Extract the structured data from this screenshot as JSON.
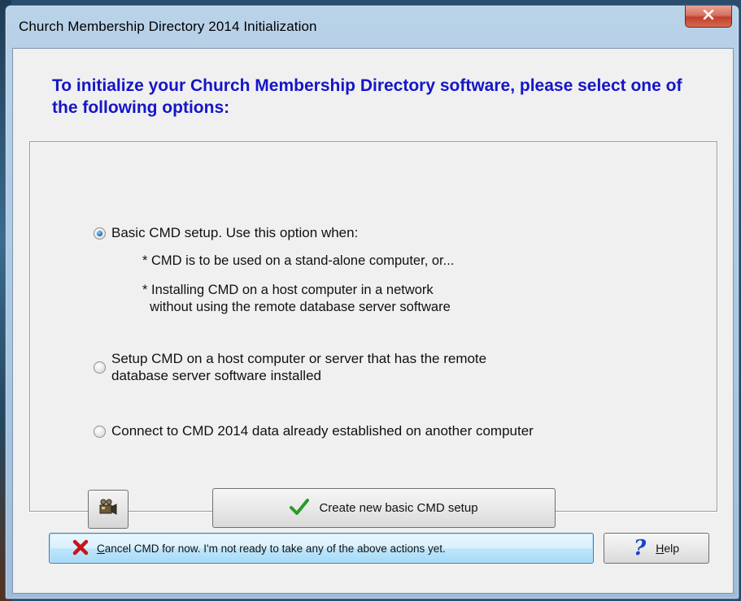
{
  "window": {
    "title": "Church Membership Directory 2014 Initialization"
  },
  "heading": "To initialize your Church Membership Directory software, please select one of the following options:",
  "options": [
    {
      "label": "Basic CMD setup. Use this option when:",
      "checked": true
    },
    {
      "label": "Setup CMD on a host computer or server that has the remote\ndatabase server software installed",
      "checked": false
    },
    {
      "label": "Connect to CMD 2014 data already established on another computer",
      "checked": false
    }
  ],
  "notes": [
    "* CMD is to be used on a stand-alone computer, or...",
    "* Installing CMD on a host computer in a network\n  without using the remote database server software"
  ],
  "buttons": {
    "create": "Create new basic CMD setup",
    "cancel": "Cancel CMD for now. I'm not ready to take any of the above actions yet.",
    "help": "Help"
  },
  "icons": {
    "close": "close-icon",
    "video": "video-camera-icon",
    "create": "checkmark-icon",
    "cancel": "red-x-icon",
    "help": "question-mark-icon"
  },
  "colors": {
    "heading": "#1515c8",
    "checkmark": "#2a9a2a",
    "cancel_x": "#c8141a",
    "help_mark": "#1a3fd0"
  }
}
